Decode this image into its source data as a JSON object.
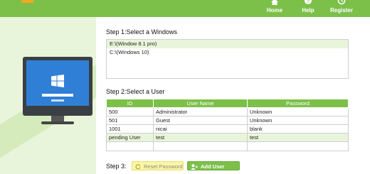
{
  "nav": {
    "home": "Home",
    "help": "Help",
    "register": "Register"
  },
  "step1": {
    "title": "Step 1:Select a Windows",
    "windows": [
      "E:\\(Window 8.1 pro)",
      "C:\\(Windows 10)"
    ],
    "selected_index": 0
  },
  "step2": {
    "title": "Step 2:Select a User",
    "columns": [
      "ID",
      "User Name",
      "Password"
    ],
    "rows": [
      [
        "500",
        "Administrator",
        "Unknown"
      ],
      [
        "501",
        "Guest",
        "Unknown"
      ],
      [
        "1001",
        "nicai",
        "blank"
      ],
      [
        "pending User",
        "test",
        "test"
      ]
    ],
    "selected_row": 3
  },
  "step3": {
    "title": "Step 3:",
    "reset_label": "Reset Password",
    "add_label": "Add User"
  },
  "colors": {
    "accent": "#7cc04a",
    "selection": "#e9f5da",
    "reset_button": "#fbf6a6",
    "screen_blue": "#2f7fd6",
    "logo_orange": "#f5a623"
  },
  "icons": [
    "home-icon",
    "help-icon",
    "register-icon",
    "windows-logo-icon",
    "refresh-icon",
    "add-user-icon"
  ]
}
